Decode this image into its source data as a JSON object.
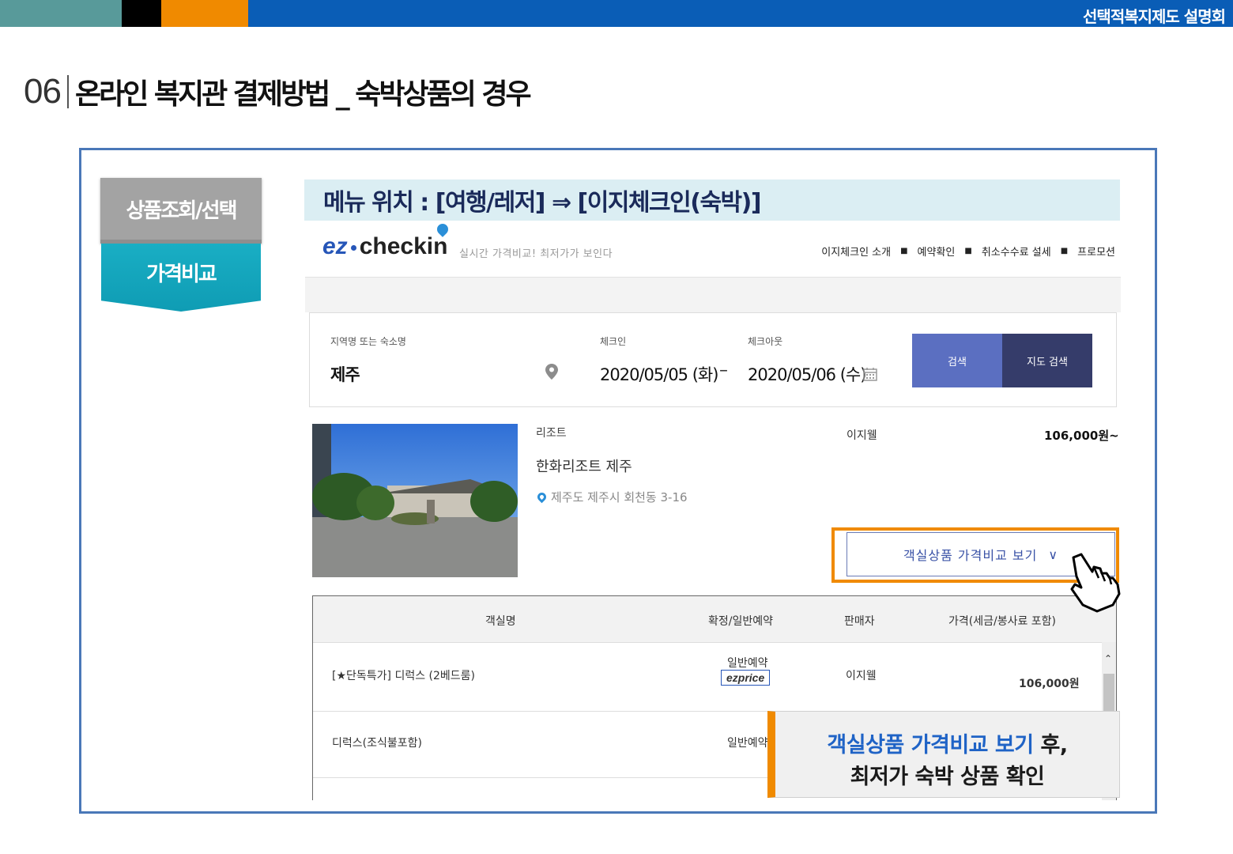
{
  "topbar": {
    "title": "선택적복지제도 설명회"
  },
  "heading": {
    "number": "06",
    "title": "온라인 복지관 결제방법 _ 숙박상품의 경우"
  },
  "steps": {
    "step1": "상품조회/선택",
    "step2": "가격비교"
  },
  "menu_label": "메뉴 위치 : [여행/레저] ⇒ [이지체크인(숙박)]",
  "ezcheckin": {
    "logo_ez": "ez",
    "logo_checkin": "checkin",
    "tagline": "실시간 가격비교! 최저가가 보인다",
    "nav": [
      "이지체크인 소개",
      "예약확인",
      "취소수수료 설세",
      "프로모션"
    ]
  },
  "search": {
    "region_label": "지역명 또는 숙소명",
    "region_value": "제주",
    "checkin_label": "체크인",
    "checkin_value": "2020/05/05 (화)",
    "dash": "–",
    "checkout_label": "체크아웃",
    "checkout_value": "2020/05/06 (수)",
    "search_button": "검색",
    "region_search_button": "지도 검색"
  },
  "hotel": {
    "category": "리조트",
    "name": "한화리조트 제주",
    "address": "제주도 제주시 회천동 3-16",
    "seller": "이지웰",
    "price": "106,000원~",
    "compare_button": "객실상품 가격비교 보기",
    "compare_chevron": "∨"
  },
  "room_table": {
    "headers": [
      "객실명",
      "확정/일반예약",
      "판매자",
      "가격(세금/봉사료 포함)"
    ],
    "rows": [
      {
        "name": "[★단독특가] 디럭스 (2베드룸)",
        "type": "일반예약",
        "badge": "ezprice",
        "seller": "이지웰",
        "price": "106,000원"
      },
      {
        "name": "디럭스(조식불포함)",
        "type": "일반예약",
        "badge": "",
        "seller": "",
        "price": ""
      }
    ],
    "scroll_arrow": "⌃"
  },
  "callout": {
    "line1_blue": "객실상품 가격비교 보기",
    "line1_dark": " 후,",
    "line2": "최저가 숙박 상품 확인"
  },
  "colors": {
    "accent_orange": "#f08a00",
    "brand_blue": "#0a5db6",
    "teal": "#19aec4",
    "frame_blue": "#4a78b8"
  }
}
